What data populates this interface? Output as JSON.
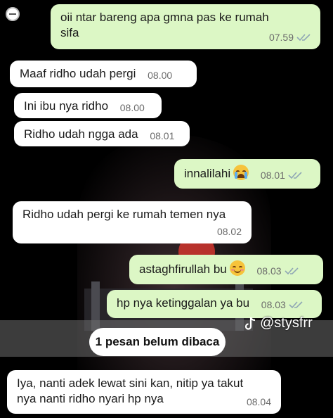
{
  "messages": [
    {
      "dir": "out",
      "text": "oii ntar bareng apa gmna pas ke rumah\nsifa",
      "time": "07.59",
      "read": true
    },
    {
      "dir": "in",
      "text": "Maaf ridho udah pergi",
      "time": "08.00"
    },
    {
      "dir": "in",
      "text": "Ini ibu nya ridho",
      "time": "08.00"
    },
    {
      "dir": "in",
      "text": "Ridho udah ngga ada",
      "time": "08.01"
    },
    {
      "dir": "out",
      "text": "innalilahi",
      "emoji": "loudly-crying-face-icon",
      "time": "08.01",
      "read": true
    },
    {
      "dir": "in",
      "text": "Ridho udah pergi ke rumah temen nya",
      "time": "08.02"
    },
    {
      "dir": "out",
      "text": "astaghfirullah bu",
      "emoji": "smiling-face-icon",
      "time": "08.03",
      "read": true
    },
    {
      "dir": "out",
      "text": "hp nya ketinggalan ya bu",
      "time": "08.03",
      "read": true
    },
    {
      "dir": "in",
      "text": "Iya, nanti adek lewat sini kan, nitip ya takut\nnya nanti ridho nyari hp nya",
      "time": "08.04"
    }
  ],
  "unread_banner": "1 pesan belum dibaca",
  "watermark": "@stysfrr",
  "colors": {
    "outgoing_bubble": "#dcf7c5",
    "incoming_bubble": "#ffffff",
    "read_ticks": "#8fa6b5"
  }
}
